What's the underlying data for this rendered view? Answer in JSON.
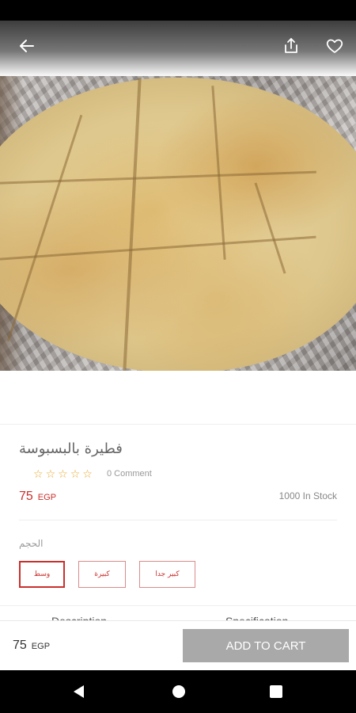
{
  "product": {
    "title": "فطيرة بالبسبوسة",
    "rating_stars": 5,
    "comment_count": "0 Comment",
    "price": "75",
    "currency": "EGP",
    "stock": "1000 In Stock",
    "image_icon": "product-photo"
  },
  "header": {
    "back_icon": "arrow-left-icon",
    "share_icon": "share-icon",
    "favorite_icon": "heart-outline-icon"
  },
  "options": {
    "label": "الحجم",
    "sizes": [
      {
        "label": "وسط",
        "selected": true
      },
      {
        "label": "كبيرة",
        "selected": false
      },
      {
        "label": "كبير جدا",
        "selected": false
      }
    ]
  },
  "tabs": [
    "Description",
    "Specification"
  ],
  "bottom_bar": {
    "price": "75",
    "currency": "EGP",
    "add_to_cart_label": "ADD TO CART"
  },
  "colors": {
    "accent": "#c9302c",
    "button_disabled": "#a9a9a9",
    "star": "#e9a82c"
  }
}
